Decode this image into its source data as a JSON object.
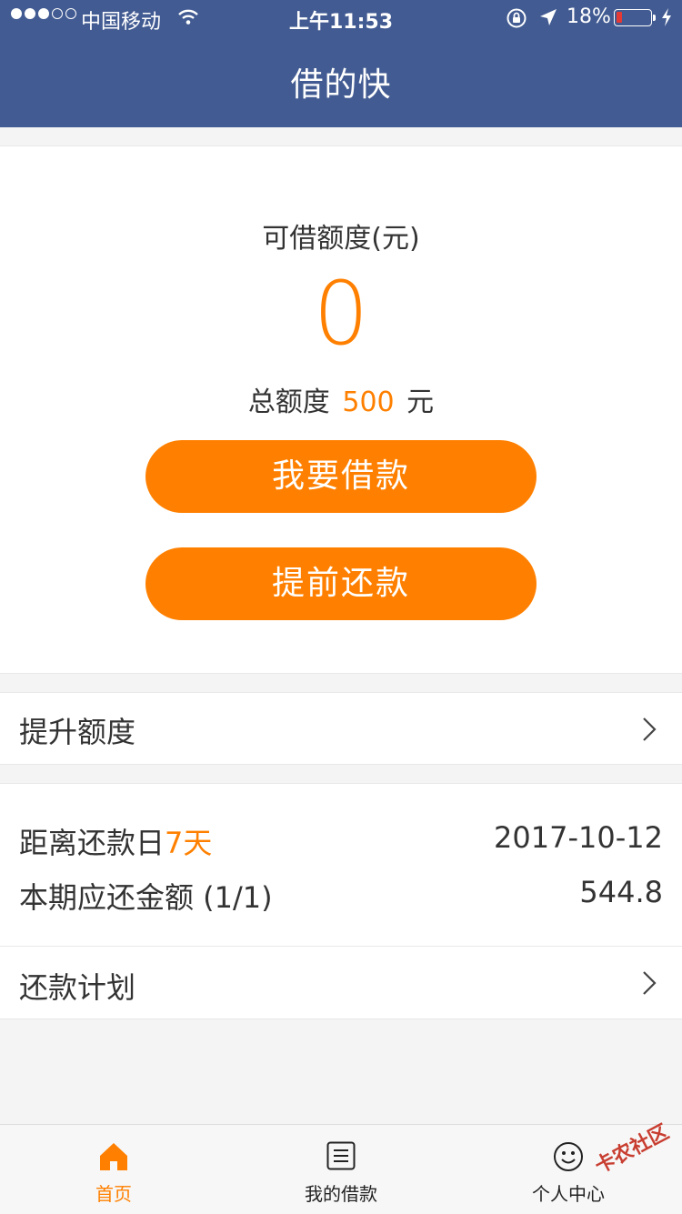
{
  "status_bar": {
    "carrier": "中国移动",
    "time": "上午11:53",
    "battery_percent": "18%",
    "battery_level": 0.18,
    "signal_bars_filled": 3,
    "signal_bars_total": 5
  },
  "nav": {
    "title": "借的快"
  },
  "quota": {
    "label": "可借额度(元)",
    "amount": "0",
    "total_prefix": "总额度",
    "total_value": "500",
    "total_unit": "元"
  },
  "actions": {
    "borrow": "我要借款",
    "repay_early": "提前还款"
  },
  "raise_limit": {
    "label": "提升额度"
  },
  "repayment": {
    "days_label": "距离还款日",
    "days_value": "7天",
    "due_date": "2017-10-12",
    "amount_label": "本期应还金额 (1/1)",
    "amount_value": "544.8",
    "plan_label": "还款计划"
  },
  "tabs": [
    {
      "label": "首页",
      "icon": "home-icon",
      "active": true
    },
    {
      "label": "我的借款",
      "icon": "list-icon",
      "active": false
    },
    {
      "label": "个人中心",
      "icon": "smiley-icon",
      "active": false
    }
  ],
  "watermark": "卡农社区",
  "colors": {
    "nav_bg": "#425b92",
    "accent": "#ff8000",
    "battery_low": "#e53935"
  }
}
